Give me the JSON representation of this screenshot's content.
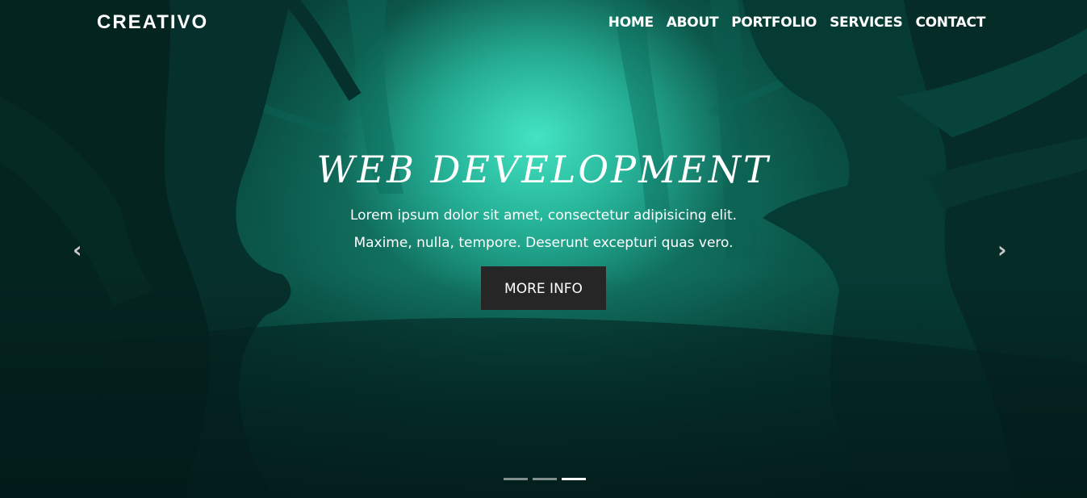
{
  "brand": "CREATIVO",
  "nav": {
    "items": [
      "HOME",
      "ABOUT",
      "PORTFOLIO",
      "SERVICES",
      "CONTACT"
    ]
  },
  "slide": {
    "title": "WEB DEVELOPMENT",
    "line1": "Lorem ipsum dolor sit amet, consectetur adipisicing elit.",
    "line2": "Maxime, nulla, tempore. Deserunt excepturi quas vero.",
    "button": "MORE INFO"
  },
  "carousel": {
    "prev_icon": "chevron-left-icon",
    "next_icon": "chevron-right-icon",
    "prev_glyph": "‹",
    "next_glyph": "›",
    "indicator_count": 3,
    "active_indicator": 3
  },
  "colors": {
    "accent_glow": "#46ebc8",
    "button_bg": "#262626",
    "text": "#ffffff"
  }
}
